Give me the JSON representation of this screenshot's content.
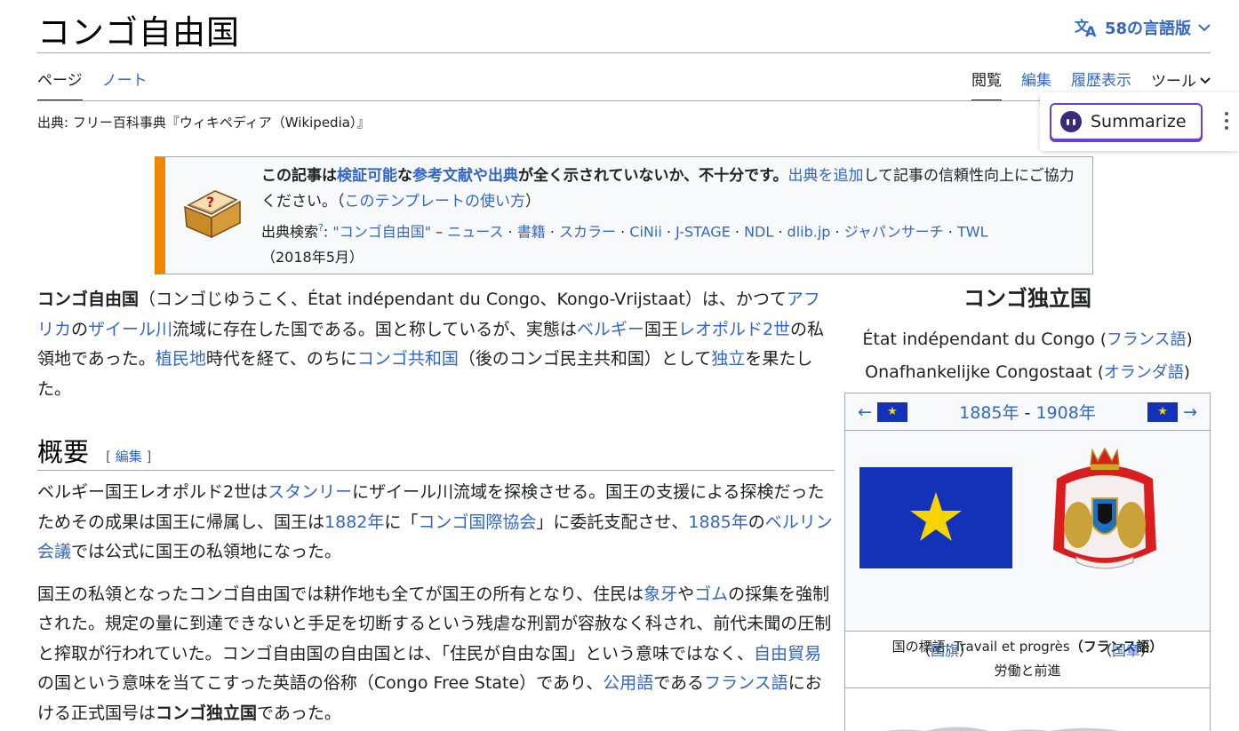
{
  "header": {
    "title": "コンゴ自由国",
    "languages_label": "58の言語版"
  },
  "tabs": {
    "left": [
      "ページ",
      "ノート"
    ],
    "right": [
      "閲覧",
      "編集",
      "履歴表示"
    ],
    "tools_label": "ツール"
  },
  "source_line": "出典: フリー百科事典『ウィキペディア（Wikipedia）』",
  "summarize": {
    "label": "Summarize"
  },
  "notice": {
    "bold1": "この記事は",
    "link1": "検証可能",
    "bold2": "な",
    "link2": "参考文献や出典",
    "bold3": "が全く示されていないか、不十分です。",
    "link3": "出典を追加",
    "tail": "して記事の信頼性向上にご協力ください。（",
    "link4": "このテンプレートの使い方",
    "close": "）",
    "search_label": "出典検索",
    "search_sup": "?",
    "search_colon": ": ",
    "search_query": "\"コンゴ自由国\"",
    "search_links": [
      "ニュース",
      "書籍",
      "スカラー",
      "CiNii",
      "J-STAGE",
      "NDL",
      "dlib.jp",
      "ジャパンサーチ",
      "TWL"
    ],
    "date": "（2018年5月）"
  },
  "lead": {
    "bold": "コンゴ自由国",
    "t1": "（コンゴじゆうこく、État indépendant du Congo、Kongo-Vrijstaat）は、かつて",
    "l1": "アフリカ",
    "t2": "の",
    "l2": "ザイール川",
    "t3": "流域に存在した国である。国と称しているが、実態は",
    "l3": "ベルギー",
    "t4": "国王",
    "l4": "レオポルド2世",
    "t5": "の私領地であった。",
    "l5": "植民地",
    "t6": "時代を経て、のちに",
    "l6": "コンゴ共和国",
    "t7": "（後のコンゴ民主共和国）として",
    "l7": "独立",
    "t8": "を果たした。"
  },
  "section": {
    "heading": "概要",
    "edit_open": "[ ",
    "edit": "編集",
    "edit_close": " ]"
  },
  "para1": {
    "t1": "ベルギー国王レオポルド2世は",
    "l1": "スタンリー",
    "t2": "にザイール川流域を探検させる。国王の支援による探検だったためその成果は国王に帰属し、国王は",
    "l2": "1882年",
    "t3": "に「",
    "l3": "コンゴ国際協会",
    "t4": "」に委託支配させ、",
    "l4": "1885年",
    "t5": "の",
    "l5": "ベルリン会議",
    "t6": "では公式に国王の私領地になった。"
  },
  "para2": {
    "t1": "国王の私領となったコンゴ自由国では耕作地も全てが国王の所有となり、住民は",
    "l1": "象牙",
    "t2": "や",
    "l2": "ゴム",
    "t3": "の採集を強制された。規定の量に到達できないと手足を切断するという残虐な刑罰が容赦なく科され、前代未聞の圧制と搾取が行われていた。コンゴ自由国の自由国とは、「住民が自由な国」という意味ではなく、",
    "l3": "自由貿易",
    "t4": "の国という意味を当てこすった英語の俗称（Congo Free State）であり、",
    "l4": "公用語",
    "t5": "である",
    "l5": "フランス語",
    "t6": "における正式国号は",
    "b1": "コンゴ独立国",
    "t7": "であった。"
  },
  "infobox": {
    "title": "コンゴ独立国",
    "name_fr": "État indépendant du Congo",
    "lang_fr": "フランス語",
    "name_nl": "Onafhankelijke Congostaat",
    "lang_nl": "オランダ語",
    "prev_arrow": "←",
    "next_arrow": "→",
    "year_start": "1885年",
    "year_sep": " - ",
    "year_end": "1908年",
    "flag_caption": "国旗",
    "coat_caption": "国章",
    "motto_label": "国の標語",
    "motto": "Travail et progrès",
    "motto_lang": "（フランス語）",
    "motto_translation": "労働と前進"
  },
  "colors": {
    "link": "#3366cc",
    "notice_bar": "#f28500",
    "flag_blue": "#1432b8",
    "flag_star": "#f5d400",
    "summarize_border": "#6a3fd9"
  }
}
